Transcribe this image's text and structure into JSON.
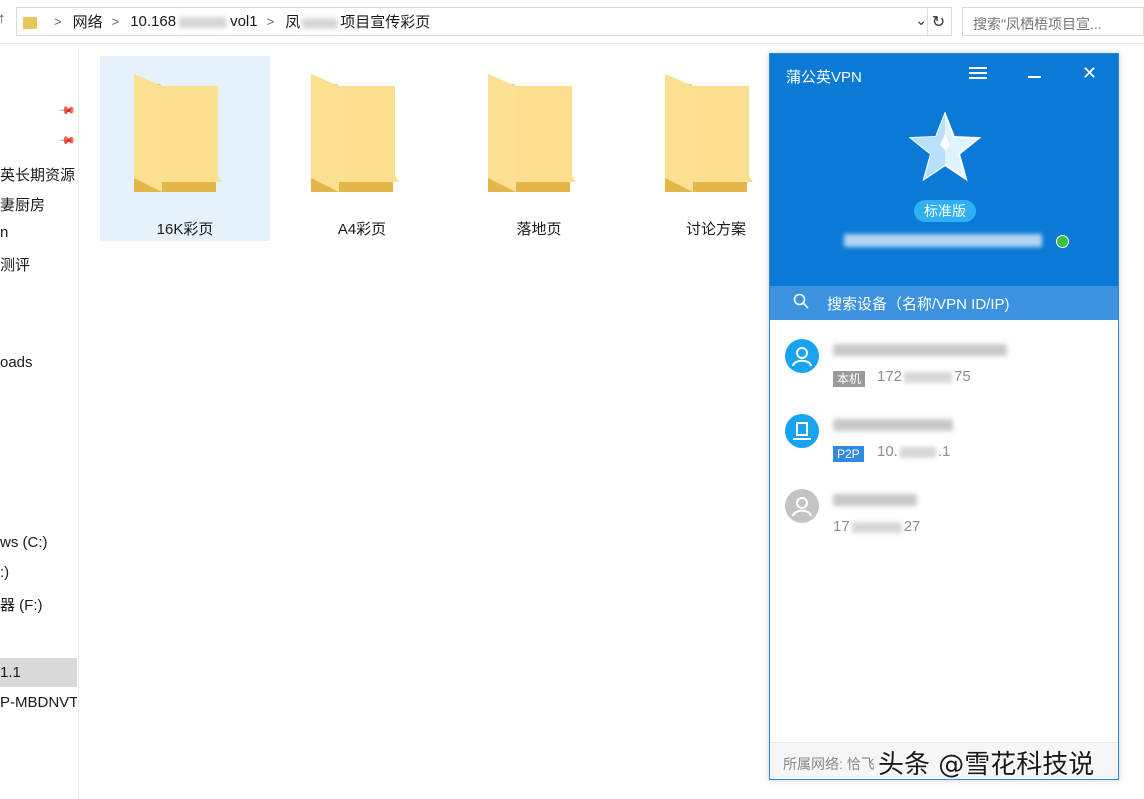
{
  "explorer": {
    "breadcrumb": {
      "network": "网络",
      "host_prefix": "10.168",
      "share": "vol1",
      "folder_prefix": "凤",
      "folder_suffix": "项目宣传彩页"
    },
    "search_placeholder": "搜索\"凤栖梧项目宣...",
    "nav_items": [
      {
        "label": ""
      },
      {
        "label": ""
      },
      {
        "label": "英长期资源"
      },
      {
        "label": "妻厨房"
      },
      {
        "label": "n"
      },
      {
        "label": "测评"
      },
      {
        "label": ""
      },
      {
        "label": "oads"
      },
      {
        "label": "ws (C:)"
      },
      {
        "label": ":)"
      },
      {
        "label": "器 (F:)"
      },
      {
        "label": "1.1"
      },
      {
        "label": "P-MBDNVT"
      }
    ],
    "folders": [
      {
        "label": "16K彩页"
      },
      {
        "label": "A4彩页"
      },
      {
        "label": "落地页"
      },
      {
        "label": "讨论方案"
      }
    ]
  },
  "vpn": {
    "title": "蒲公英VPN",
    "edition": "标准版",
    "search_placeholder": "搜索设备（名称/VPN ID/IP)",
    "devices": [
      {
        "tag": "本机",
        "ip_prefix": "172",
        "ip_suffix": "75",
        "status": "online",
        "type": "user"
      },
      {
        "tag": "P2P",
        "ip_prefix": "10.",
        "ip_suffix": ".1",
        "status": "online",
        "type": "router"
      },
      {
        "tag": "",
        "ip_prefix": "17",
        "ip_suffix": "27",
        "status": "offline",
        "type": "user"
      }
    ],
    "footer_label": "所属网络: 恰飞",
    "colors": {
      "primary": "#0a7ad6",
      "online": "#35c235",
      "badge": "#2fb0f2"
    }
  },
  "watermark": "头条 @雪花科技说"
}
